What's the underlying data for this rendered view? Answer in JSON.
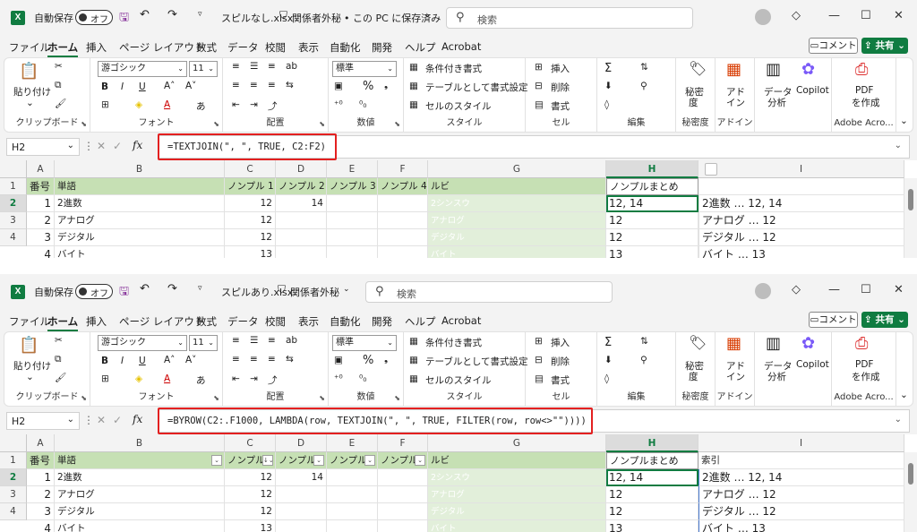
{
  "windows": [
    {
      "autosave_label": "自動保存",
      "autosave_state": "オフ",
      "filename": "スピルなし.xlsx",
      "sensitivity": "関係者外秘",
      "save_status": "• この PC に保存済み",
      "search_placeholder": "検索",
      "menu": [
        "ファイル",
        "ホーム",
        "挿入",
        "ページ レイアウト",
        "数式",
        "データ",
        "校閲",
        "表示",
        "自動化",
        "開発",
        "ヘルプ",
        "Acrobat"
      ],
      "comment_label": "コメント",
      "share_label": "共有",
      "ribbon": {
        "paste": "貼り付け",
        "clipboard": "クリップボード",
        "font_name": "游ゴシック",
        "font_size": "11",
        "font": "フォント",
        "alignment": "配置",
        "number_format": "標準",
        "number": "数値",
        "cond_format": "条件付き書式",
        "table_format": "テーブルとして書式設定",
        "cell_style": "セルのスタイル",
        "styles": "スタイル",
        "insert": "挿入",
        "delete": "削除",
        "format": "書式",
        "cells": "セル",
        "editing": "編集",
        "sensitivity": "秘密度",
        "sensitivity_l1": "秘密",
        "sensitivity_l2": "度",
        "addin_l1": "アド",
        "addin_l2": "イン",
        "addins": "アドイン",
        "data_analysis_l1": "データ",
        "data_analysis_l2": "分析",
        "copilot": "Copilot",
        "pdf_l1": "PDF",
        "pdf_l2": "を作成",
        "adobe": "Adobe Acro..."
      },
      "name_box": "H2",
      "formula": "=TEXTJOIN(\", \", TRUE, C2:F2)",
      "columns": [
        "A",
        "B",
        "C",
        "D",
        "E",
        "F",
        "G",
        "H",
        "I"
      ],
      "row_numbers": [
        "1",
        "2",
        "3",
        "4"
      ],
      "headers": [
        "番号",
        "単語",
        "ノンプル 1",
        "ノンプル 2",
        "ノンプル 3",
        "ノンプル 4",
        "ルビ",
        "ノンプルまとめ",
        ""
      ],
      "rows": [
        [
          "1",
          "2進数",
          "12",
          "14",
          "",
          "",
          "2シンスウ",
          "12, 14",
          "2進数 … 12, 14"
        ],
        [
          "2",
          "アナログ",
          "12",
          "",
          "",
          "",
          "アナログ",
          "12",
          "アナログ … 12"
        ],
        [
          "3",
          "デジタル",
          "12",
          "",
          "",
          "",
          "デジタル",
          "12",
          "デジタル … 12"
        ],
        [
          "4",
          "バイト",
          "13",
          "",
          "",
          "",
          "バイト",
          "13",
          "バイト … 13"
        ]
      ]
    },
    {
      "autosave_label": "自動保存",
      "autosave_state": "オフ",
      "filename": "スピルあり.xlsx",
      "sensitivity": "関係者外秘",
      "save_status": "",
      "search_placeholder": "検索",
      "menu": [
        "ファイル",
        "ホーム",
        "挿入",
        "ページ レイアウト",
        "数式",
        "データ",
        "校閲",
        "表示",
        "自動化",
        "開発",
        "ヘルプ",
        "Acrobat"
      ],
      "comment_label": "コメント",
      "share_label": "共有",
      "ribbon": {
        "paste": "貼り付け",
        "clipboard": "クリップボード",
        "font_name": "游ゴシック",
        "font_size": "11",
        "font": "フォント",
        "alignment": "配置",
        "number_format": "標準",
        "number": "数値",
        "cond_format": "条件付き書式",
        "table_format": "テーブルとして書式設定",
        "cell_style": "セルのスタイル",
        "styles": "スタイル",
        "insert": "挿入",
        "delete": "削除",
        "format": "書式",
        "cells": "セル",
        "editing": "編集",
        "sensitivity": "秘密度",
        "sensitivity_l1": "秘密",
        "sensitivity_l2": "度",
        "addin_l1": "アド",
        "addin_l2": "イン",
        "addins": "アドイン",
        "data_analysis_l1": "データ",
        "data_analysis_l2": "分析",
        "copilot": "Copilot",
        "pdf_l1": "PDF",
        "pdf_l2": "を作成",
        "adobe": "Adobe Acro..."
      },
      "name_box": "H2",
      "formula": "=BYROW(C2:.F1000, LAMBDA(row, TEXTJOIN(\", \", TRUE, FILTER(row, row<>\"\"))))",
      "columns": [
        "A",
        "B",
        "C",
        "D",
        "E",
        "F",
        "G",
        "H",
        "I"
      ],
      "row_numbers": [
        "1",
        "2",
        "3",
        "4"
      ],
      "headers": [
        "番号",
        "単語",
        "ノンプル",
        "ノンプル",
        "ノンプル",
        "ノンプル",
        "ルビ",
        "ノンプルまとめ",
        "索引"
      ],
      "rows": [
        [
          "1",
          "2進数",
          "12",
          "14",
          "",
          "",
          "2シンスウ",
          "12, 14",
          "2進数 … 12, 14"
        ],
        [
          "2",
          "アナログ",
          "12",
          "",
          "",
          "",
          "アナログ",
          "12",
          "アナログ … 12"
        ],
        [
          "3",
          "デジタル",
          "12",
          "",
          "",
          "",
          "デジタル",
          "12",
          "デジタル … 12"
        ],
        [
          "4",
          "バイト",
          "13",
          "",
          "",
          "",
          "バイト",
          "13",
          "バイト … 13"
        ]
      ]
    }
  ],
  "colors": {
    "accent": "#107c41",
    "header_fill": "#c6e0b4",
    "ruby_fill": "#e2efda",
    "highlight": "#e32020"
  }
}
